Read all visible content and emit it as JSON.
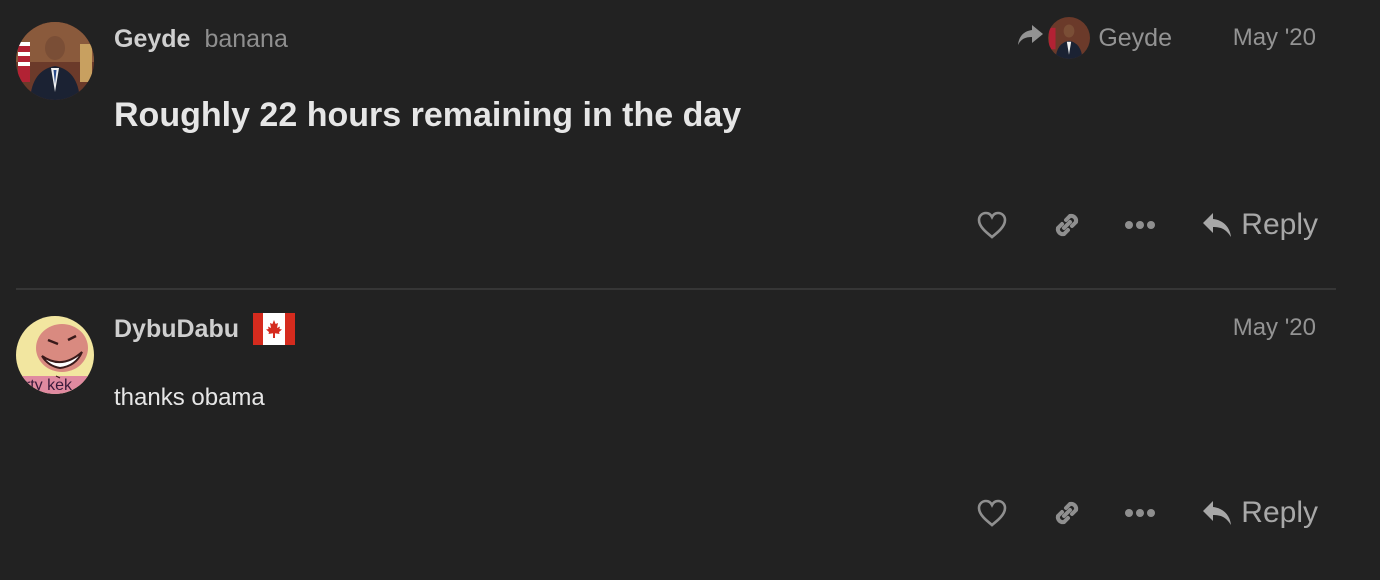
{
  "posts": [
    {
      "username": "Geyde",
      "user_title": "banana",
      "reply_to": {
        "username": "Geyde",
        "icon": "share-arrow-icon"
      },
      "date": "May '20",
      "body": "Roughly 22 hours remaining in the day",
      "actions": {
        "like_icon": "heart-icon",
        "link_icon": "link-icon",
        "more_icon": "ellipsis-icon",
        "reply_label": "Reply"
      }
    },
    {
      "username": "DybuDabu",
      "flag": "canada-flag",
      "avatar_text": "arty kek",
      "date": "May '20",
      "body": "thanks obama",
      "actions": {
        "like_icon": "heart-icon",
        "link_icon": "link-icon",
        "more_icon": "ellipsis-icon",
        "reply_label": "Reply"
      }
    }
  ],
  "colors": {
    "background": "#222222",
    "muted": "#8f8f8f",
    "text": "#e6e6e6",
    "flag_red": "#d52b1e"
  }
}
